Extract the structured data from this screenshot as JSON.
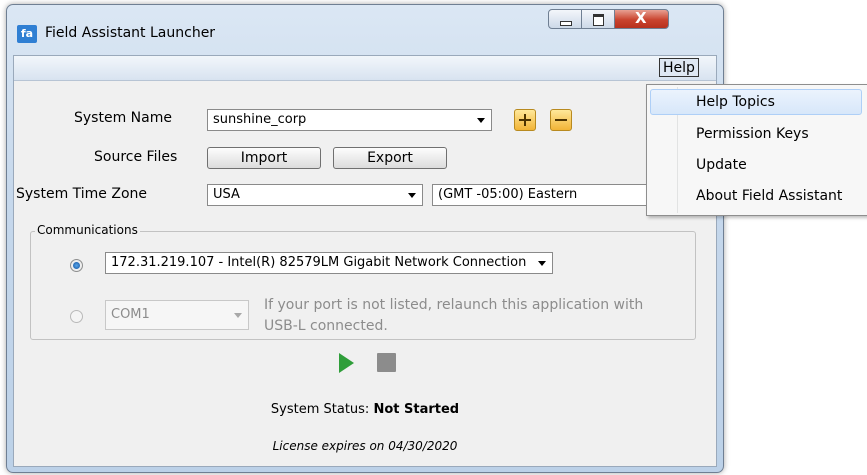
{
  "window": {
    "title": "Field Assistant Launcher",
    "icon_text": "fa",
    "close_glyph": "X"
  },
  "menubar": {
    "help_label": "Help"
  },
  "help_menu": {
    "items": [
      "Help Topics",
      "Permission Keys",
      "Update",
      "About Field Assistant"
    ],
    "highlighted": "Help Topics"
  },
  "form": {
    "system_name_label": "System Name",
    "system_name_value": "sunshine_corp",
    "source_files_label": "Source Files",
    "import_label": "Import",
    "export_label": "Export",
    "time_zone_label": "System Time Zone",
    "time_zone_region": "USA",
    "time_zone_offset": "(GMT -05:00) Eastern"
  },
  "communications": {
    "title": "Communications",
    "network_value": "172.31.219.107 - Intel(R) 82579LM Gigabit Network Connection",
    "network_selected": true,
    "serial_value": "COM1",
    "serial_hint": "If your port is not listed, relaunch this application with USB-L connected."
  },
  "status": {
    "label": "System Status:",
    "value": "Not Started",
    "license": "License expires on 04/30/2020"
  },
  "icons": {
    "play": "play-icon",
    "stop": "stop-icon",
    "add": "plus-icon",
    "remove": "minus-icon"
  },
  "colors": {
    "play_green": "#2f9e3a",
    "stop_gray": "#8c8c8c",
    "add_remove_yellow": "#f2b437"
  }
}
